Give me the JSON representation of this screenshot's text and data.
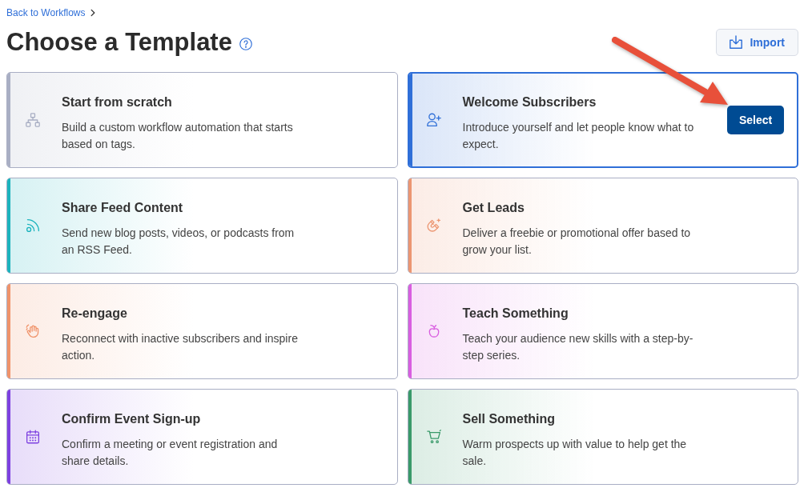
{
  "breadcrumb": {
    "link": "Back to Workflows"
  },
  "header": {
    "title": "Choose a Template",
    "import_button": "Import"
  },
  "templates": [
    {
      "title": "Start from scratch",
      "description": "Build a custom workflow automation that starts based on tags.",
      "color": "#a9afc4",
      "selected": false
    },
    {
      "title": "Welcome Subscribers",
      "description": "Introduce yourself and let people know what to expect.",
      "color": "#2f6fd8",
      "selected": true,
      "button": "Select"
    },
    {
      "title": "Share Feed Content",
      "description": "Send new blog posts, videos, or podcasts from an RSS Feed.",
      "color": "#1bb3bd",
      "selected": false
    },
    {
      "title": "Get Leads",
      "description": "Deliver a freebie or promotional offer based to grow your list.",
      "color": "#ec9672",
      "selected": false
    },
    {
      "title": "Re-engage",
      "description": "Reconnect with inactive subscribers and inspire action.",
      "color": "#f0936a",
      "selected": false
    },
    {
      "title": "Teach Something",
      "description": "Teach your audience new skills with a step-by-step series.",
      "color": "#d95fe0",
      "selected": false
    },
    {
      "title": "Confirm Event Sign-up",
      "description": "Confirm a meeting or event registration and share details.",
      "color": "#7d40e0",
      "selected": false
    },
    {
      "title": "Sell Something",
      "description": "Warm prospects up with value to help get the sale.",
      "color": "#3a9a6a",
      "selected": false
    }
  ],
  "annotation": {
    "kind": "arrow"
  }
}
